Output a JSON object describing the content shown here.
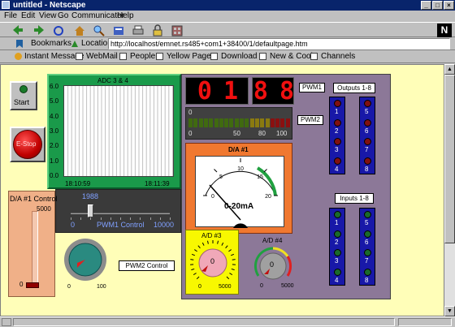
{
  "window": {
    "title": "untitled - Netscape"
  },
  "menu": [
    "File",
    "Edit",
    "View",
    "Go",
    "Communicator",
    "Help"
  ],
  "location": {
    "bookmarks_label": "Bookmarks",
    "location_label": "Location:",
    "url": "http://localhost/emnet.rs485+com1+38400/1/defaultpage.htm"
  },
  "personal": [
    "Instant Message",
    "WebMail",
    "People",
    "Yellow Pages",
    "Download",
    "New & Cool",
    "Channels"
  ],
  "panel": {
    "start_label": "Start",
    "estop_label": "E-Stop",
    "adc_title": "ADC 3 & 4",
    "adc_y_ticks": [
      "6.0",
      "5.0",
      "4.0",
      "3.0",
      "2.0",
      "1.0",
      "0.0"
    ],
    "adc_time_start": "18:10:59",
    "adc_time_end": "18:11:39",
    "adc_chart": {
      "type": "line",
      "ylim": [
        0,
        6
      ],
      "x_start": "18:10:59",
      "x_end": "18:11:39",
      "series": []
    },
    "da_control_label": "D/A #1 Control",
    "da_slider_max": "5000",
    "da_slider_min": "0",
    "da_slider_level": 0.0,
    "pwm1_value": "1988",
    "pwm1_min": "0",
    "pwm1_max": "10000",
    "pwm1_control_label": "PWM1 Control",
    "pwm1_fraction": 0.1988,
    "pwm2_knob_min": "0",
    "pwm2_knob_max": "100",
    "pwm2_control_label": "PWM2 Control",
    "display1_digits": "0 1 9",
    "display2_digits": "8 8",
    "pwm1_label": "PWM1",
    "pwm2_label": "PWM2",
    "bar_ticks": [
      "0",
      "50",
      "80",
      "100"
    ],
    "bar_top_zero": "0",
    "bar_level": 0.0,
    "meter_title": "D/A #1",
    "meter_ticks": [
      "0",
      "5",
      "10",
      "15",
      "20"
    ],
    "meter_unit": "0-20mA",
    "ad3_title": "A/D #3",
    "ad3_min": "0",
    "ad3_max": "5000",
    "ad3_center": "0",
    "ad4_title": "A/D #4",
    "ad4_min": "0",
    "ad4_max": "5000",
    "ad4_center": "0",
    "outputs_label": "Outputs 1-8",
    "inputs_label": "Inputs 1-8",
    "outputs_left": [
      "1",
      "2",
      "3",
      "4"
    ],
    "outputs_right": [
      "5",
      "6",
      "7",
      "8"
    ],
    "inputs_left": [
      "1",
      "2",
      "3",
      "4"
    ],
    "inputs_right": [
      "5",
      "6",
      "7",
      "8"
    ]
  },
  "colors": {
    "panel_purple": "#8c7898",
    "adc_green": "#1a9a4a",
    "dark_panel": "#3a3a3a",
    "orange": "#f07830",
    "yellow": "#f8f800",
    "led_red": "#801010",
    "led_green": "#1a6a2a",
    "led_panel": "#1818a8"
  }
}
